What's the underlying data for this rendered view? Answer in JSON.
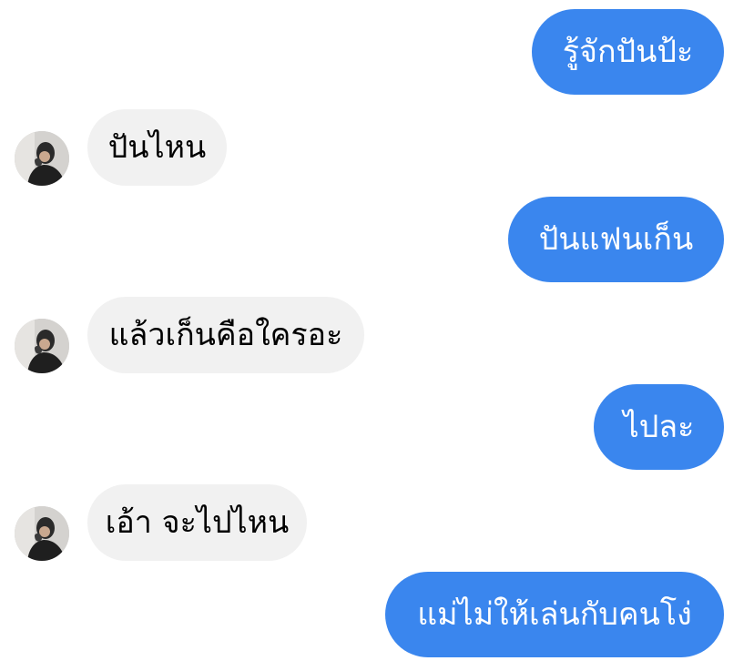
{
  "messages": [
    {
      "direction": "outgoing",
      "text": "รู้จักปันป้ะ"
    },
    {
      "direction": "incoming",
      "text": "ปันไหน"
    },
    {
      "direction": "outgoing",
      "text": "ปันแฟนเก็น"
    },
    {
      "direction": "incoming",
      "text": "แล้วเก็นคือใครอะ"
    },
    {
      "direction": "outgoing",
      "text": "ไปละ"
    },
    {
      "direction": "incoming",
      "text": "เอ้า จะไปไหน"
    },
    {
      "direction": "outgoing",
      "text": "แม่ไม่ให้เล่นกับคนโง่"
    }
  ],
  "colors": {
    "outgoing_bubble": "#3a86ee",
    "incoming_bubble": "#f1f1f1",
    "outgoing_text": "#ffffff",
    "incoming_text": "#000000"
  },
  "icons": {
    "contact_avatar": "contact-avatar-photo"
  }
}
